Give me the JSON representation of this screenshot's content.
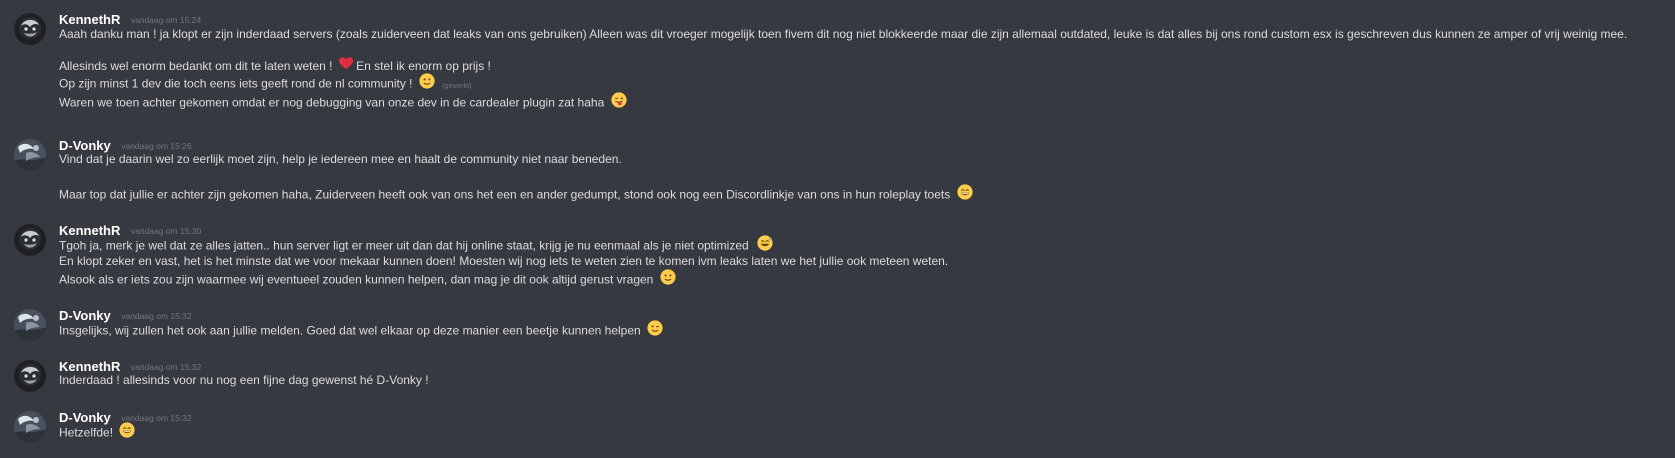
{
  "messages": [
    {
      "author": "KennethR",
      "timestamp": "vandaag om 15:24",
      "lines": [
        "Aaah danku man ! ja klopt er zijn inderdaad servers (zoals zuiderveen dat leaks van ons gebruiken) Alleen was dit vroeger mogelijk toen fivem dit nog niet blokkeerde maar die zijn allemaal outdated, leuke is dat alles bij ons rond custom esx is geschreven dus kunnen ze amper of vrij weinig mee.",
        "Allesinds wel enorm bedankt om dit te laten weten !",
        "En stel ik enorm op prijs !",
        "Op zijn minst 1 dev die toch eens iets geeft rond de nl community !",
        "(gewerkt)",
        "Waren we toen achter gekomen omdat er nog debugging van onze dev in de cardealer plugin zat haha"
      ]
    },
    {
      "author": "D-Vonky",
      "timestamp": "vandaag om 15:26",
      "lines": [
        "Vind dat je daarin wel zo eerlijk moet zijn, help je iedereen mee en haalt de community niet naar beneden.",
        "Maar top dat jullie er achter zijn gekomen haha, Zuiderveen heeft ook van ons het een en ander gedumpt, stond ook nog een Discordlinkje van ons in hun roleplay toets"
      ]
    },
    {
      "author": "KennethR",
      "timestamp": "vandaag om 15:30",
      "lines": [
        "Tgoh ja, merk je wel dat ze alles jatten.. hun server ligt er meer uit dan dat hij online staat, krijg je nu eenmaal als je niet optimized",
        "En klopt zeker en vast, het is het minste dat we voor mekaar kunnen doen! Moesten wij nog iets te weten zien te komen ivm leaks  laten we het jullie ook meteen weten.",
        "Alsook als er iets zou zijn waarmee wij eventueel zouden kunnen helpen, dan mag je dit ook altijd gerust vragen"
      ]
    },
    {
      "author": "D-Vonky",
      "timestamp": "vandaag om 15:32",
      "lines": [
        "Insgelijks, wij zullen het ook aan jullie melden. Goed dat wel elkaar op deze manier een beetje kunnen helpen"
      ]
    },
    {
      "author": "KennethR",
      "timestamp": "vandaag om 15:32",
      "lines": [
        "Inderdaad ! allesinds voor nu nog een fijne dag gewenst hé D-Vonky !"
      ]
    },
    {
      "author": "D-Vonky",
      "timestamp": "vandaag om 15:32",
      "lines": [
        "Hetzelfde!"
      ]
    }
  ],
  "colors": {
    "background": "#36393f",
    "text": "#dcddde",
    "username": "#ffffff",
    "timestamp": "#72767d",
    "emoji_yellow": "#ffcc4d",
    "heart": "#dd2e44"
  },
  "icons": [
    "heart-emoji-icon",
    "slight-smile-emoji-icon",
    "tongue-wink-emoji-icon",
    "grin-emoji-icon",
    "sweat-smile-emoji-icon",
    "wink-emoji-icon"
  ]
}
